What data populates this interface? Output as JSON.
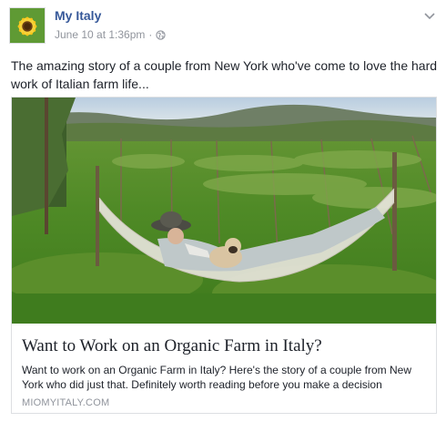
{
  "post": {
    "page_name": "My Italy",
    "timestamp": "June 10 at 1:36pm",
    "separator": "·",
    "audience_icon": "globe-icon",
    "menu_icon": "chevron-down-icon",
    "avatar_icon": "sunflower-avatar",
    "text": "The amazing story of a couple from New York who've come to love the hard work of Italian farm life..."
  },
  "link": {
    "title": "Want to Work on an Organic Farm in Italy?",
    "description": "Want to work on an Organic Farm in Italy? Here's the story of a couple from New York who did just that. Definitely worth reading before you make a decision",
    "domain": "MIOMYITALY.COM",
    "image_subject": "person-in-hammock-in-vineyard-with-dog"
  },
  "colors": {
    "link_blue": "#365899",
    "meta_gray": "#90949c",
    "text": "#1d2129",
    "border": "#dddfe2"
  }
}
